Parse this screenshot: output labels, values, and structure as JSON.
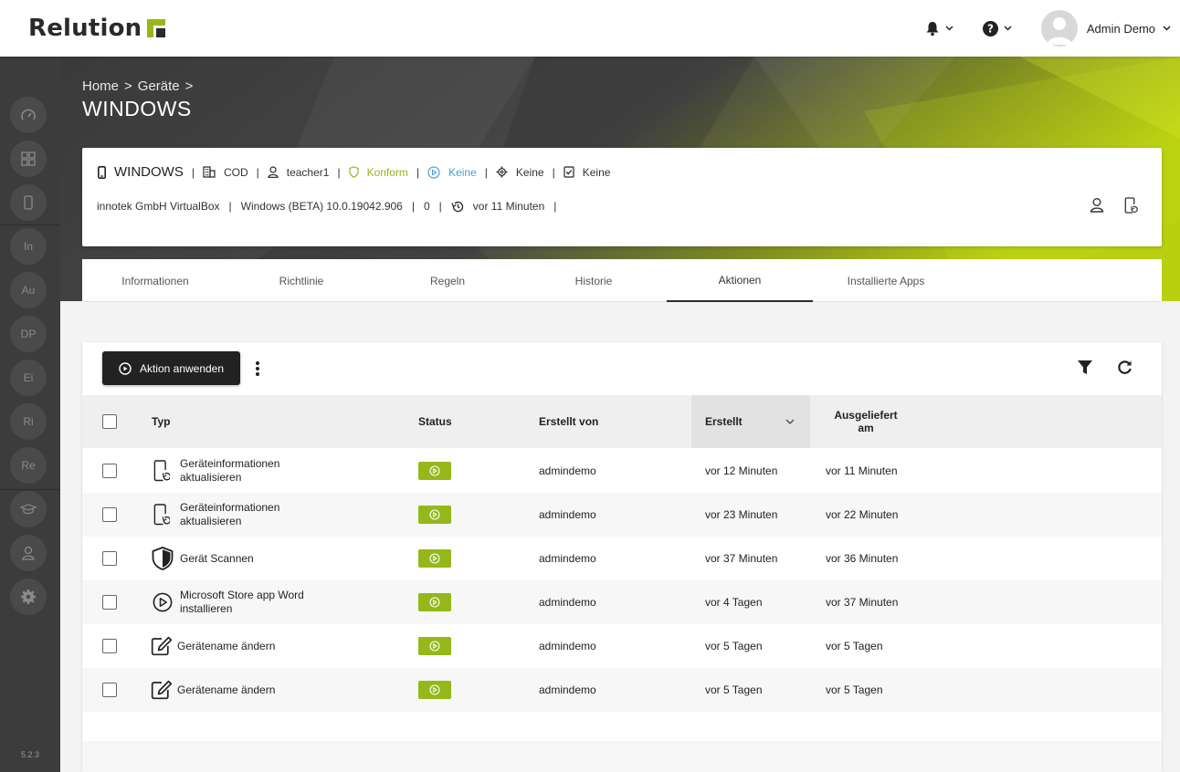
{
  "app": {
    "logo_text": "Relution"
  },
  "header": {
    "user_name": "Admin Demo"
  },
  "sidebar": {
    "items": [
      {
        "icon": "speedometer-icon"
      },
      {
        "icon": "grid-icon"
      },
      {
        "icon": "phone-icon"
      },
      {
        "label": "In"
      },
      {
        "label": "Au"
      },
      {
        "label": "DP"
      },
      {
        "label": "Ei"
      },
      {
        "label": "Ri"
      },
      {
        "label": "Re"
      },
      {
        "icon": "graduation-cap-icon"
      },
      {
        "icon": "user-icon"
      },
      {
        "icon": "gear-icon"
      }
    ],
    "version": "5.2.3"
  },
  "breadcrumb": {
    "home": "Home",
    "separator": ">",
    "devices": "Geräte"
  },
  "page_title": "WINDOWS",
  "device": {
    "name": "WINDOWS",
    "ownership": "COD",
    "user": "teacher1",
    "compliance": "Konform",
    "action_status": "Keine",
    "config_status": "Keine",
    "task_status": "Keine",
    "model": "innotek GmbH VirtualBox",
    "os": "Windows (BETA) 10.0.19042.906",
    "count": "0",
    "last_seen": "vor 11 Minuten",
    "pipe": "|"
  },
  "tabs": [
    {
      "label": "Informationen"
    },
    {
      "label": "Richtlinie"
    },
    {
      "label": "Regeln"
    },
    {
      "label": "Historie"
    },
    {
      "label": "Aktionen",
      "active": true
    },
    {
      "label": "Installierte Apps"
    }
  ],
  "toolbar": {
    "apply_label": "Aktion anwenden"
  },
  "table": {
    "columns": {
      "type": "Typ",
      "status": "Status",
      "created_by": "Erstellt von",
      "created": "Erstellt",
      "delivered_line1": "Ausgeliefert",
      "delivered_line2": "am"
    },
    "rows": [
      {
        "icon": "device-refresh-icon",
        "type_line1": "Geräteinformationen",
        "type_line2": "aktualisieren",
        "created_by": "admindemo",
        "created": "vor 12 Minuten",
        "delivered": "vor 11 Minuten"
      },
      {
        "icon": "device-refresh-icon",
        "type_line1": "Geräteinformationen",
        "type_line2": "aktualisieren",
        "created_by": "admindemo",
        "created": "vor 23 Minuten",
        "delivered": "vor 22 Minuten"
      },
      {
        "icon": "shield-icon",
        "type_line1": "Gerät Scannen",
        "type_line2": "",
        "created_by": "admindemo",
        "created": "vor 37 Minuten",
        "delivered": "vor 36 Minuten"
      },
      {
        "icon": "play-circle-icon",
        "type_line1": "Microsoft Store app Word",
        "type_line2": "installieren",
        "created_by": "admindemo",
        "created": "vor 4 Tagen",
        "delivered": "vor 37 Minuten"
      },
      {
        "icon": "edit-icon",
        "type_line1": "Gerätename ändern",
        "type_line2": "",
        "created_by": "admindemo",
        "created": "vor 5 Tagen",
        "delivered": "vor 5 Tagen"
      },
      {
        "icon": "edit-icon",
        "type_line1": "Gerätename ändern",
        "type_line2": "",
        "created_by": "admindemo",
        "created": "vor 5 Tagen",
        "delivered": "vor 5 Tagen"
      }
    ]
  },
  "colors": {
    "accent": "#94b81a",
    "dark": "#222222",
    "sidebar": "#3c3c3c",
    "info_blue": "#4a9fd8"
  }
}
